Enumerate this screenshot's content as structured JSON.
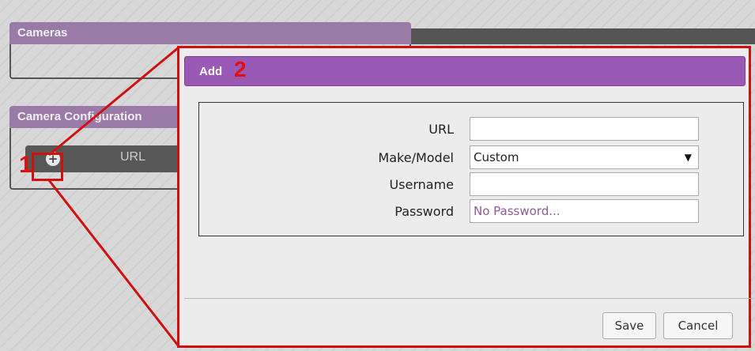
{
  "background": {
    "cameras_panel": {
      "title": "Cameras"
    },
    "camera_config_panel": {
      "title": "Camera Configuration",
      "column_label": "URL",
      "add_icon": "plus-circle-icon"
    },
    "markers": {
      "step1": "1"
    }
  },
  "dialog": {
    "title": "Add",
    "marker": "2",
    "fields": [
      {
        "label": "URL",
        "value": "",
        "placeholder": ""
      },
      {
        "label": "Make/Model",
        "value": "Custom",
        "type": "select"
      },
      {
        "label": "Username",
        "value": "",
        "placeholder": ""
      },
      {
        "label": "Password",
        "value": "",
        "placeholder": "No Password..."
      }
    ],
    "buttons": {
      "save": "Save",
      "cancel": "Cancel"
    }
  },
  "colors": {
    "header_purple": "#9b59b6",
    "highlight_red": "#d01010"
  }
}
